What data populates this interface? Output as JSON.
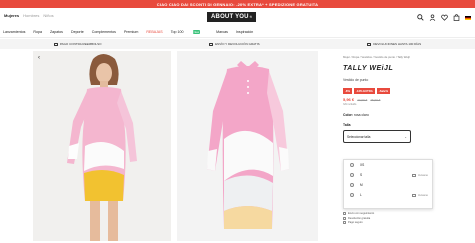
{
  "promo": {
    "text": "CIAO CIAO DAI SCONTI DI GENNAIO: -20% EXTRA* + SPEDIZIONE GRATUITA"
  },
  "header": {
    "gender": [
      "Mujeres",
      "Hombres",
      "Niños"
    ],
    "logo": "ABOUT YOU",
    "logo_sup": "®"
  },
  "nav": {
    "items": [
      "Lanzamientos",
      "Ropa",
      "Zapatos",
      "Deporte",
      "Complementos",
      "Premium",
      "REBAJAS",
      "Top 100",
      "Marcas",
      "Inspiración"
    ],
    "new_badge": "New"
  },
  "perks": [
    "PAGO CONTRA REEMBOLSO",
    "ENVÍO Y DEVOLUCIÓN GRATIS",
    "DEVOLUCIONES HASTA 100 DÍAS"
  ],
  "product": {
    "breadcrumbs": "Mujer / Ropa / Vestidos / Vestido de punto / Tally Weijl",
    "brand": "TALLY WEiJL",
    "name": "Vestido de punto",
    "badges": [
      "-8%",
      "-12% EXTRA",
      "-Sale%"
    ],
    "price": "5,96 €",
    "price_old": "27,99 €",
    "price_old2": "25,99 €",
    "price_note": "IVA incluido",
    "color_label": "Color:",
    "color_value": "rosa claro",
    "size_label": "Talla",
    "size_placeholder": "Seleccionar talla"
  },
  "size_options": [
    {
      "label": "XS",
      "note": ""
    },
    {
      "label": "S",
      "note": "Avísame"
    },
    {
      "label": "M",
      "note": ""
    },
    {
      "label": "L",
      "note": "Avísame"
    }
  ],
  "extras": [
    "Envío con seguimiento",
    "Devolución gratuita",
    "Pago seguro"
  ],
  "colors": {
    "sale": "#e84a3d",
    "pink": "#f3a6c8",
    "yellow": "#f2c230"
  }
}
